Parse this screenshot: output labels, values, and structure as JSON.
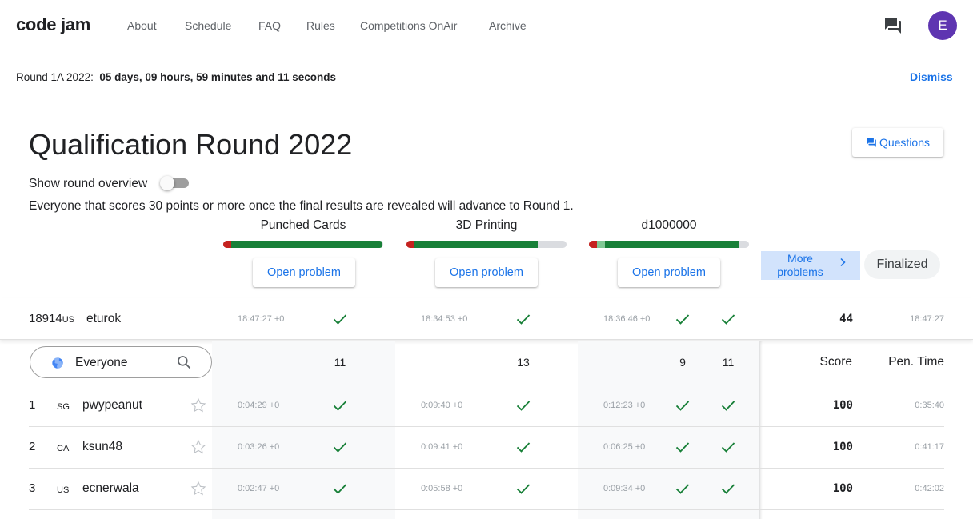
{
  "nav": {
    "logo": "code jam",
    "links": [
      "About",
      "Schedule",
      "FAQ",
      "Rules",
      "Competitions OnAir",
      "Archive"
    ],
    "avatar_letter": "E"
  },
  "countdown": {
    "label": "Round 1A 2022:",
    "time": "05 days, 09 hours, 59 minutes and 11 seconds",
    "dismiss": "Dismiss"
  },
  "header": {
    "title": "Qualification Round 2022",
    "questions_label": "Questions",
    "overview_label": "Show round overview",
    "advance_note": "Everyone that scores 30 points or more once the final results are revealed will advance to Round 1."
  },
  "problems": [
    {
      "name": "Punched Cards",
      "open_label": "Open problem"
    },
    {
      "name": "3D Printing",
      "open_label": "Open problem"
    },
    {
      "name": "d1000000",
      "open_label": "Open problem"
    }
  ],
  "more_problems_label": "More problems",
  "status_label": "Finalized",
  "user_row": {
    "rank": "18914",
    "country": "US",
    "handle": "eturok",
    "times": [
      "18:47:27 +0",
      "18:34:53 +0",
      "18:36:46 +0"
    ],
    "score": "44",
    "pen_time": "18:47:27"
  },
  "table_header": {
    "filter_value": "Everyone",
    "counts": [
      "11",
      "13",
      "9",
      "11"
    ],
    "score_label": "Score",
    "pen_label": "Pen. Time"
  },
  "rows": [
    {
      "rank": "1",
      "country": "SG",
      "handle": "pwypeanut",
      "times": [
        "0:04:29 +0",
        "0:09:40 +0",
        "0:12:23 +0"
      ],
      "score": "100",
      "pen_time": "0:35:40"
    },
    {
      "rank": "2",
      "country": "CA",
      "handle": "ksun48",
      "times": [
        "0:03:26 +0",
        "0:09:41 +0",
        "0:06:25 +0"
      ],
      "score": "100",
      "pen_time": "0:41:17"
    },
    {
      "rank": "3",
      "country": "US",
      "handle": "ecnerwala",
      "times": [
        "0:02:47 +0",
        "0:05:58 +0",
        "0:09:34 +0"
      ],
      "score": "100",
      "pen_time": "0:42:02"
    }
  ],
  "colors": {
    "accent": "#1a73e8",
    "check": "#188038",
    "fail": "#c5221f",
    "avatar": "#5e35b1"
  },
  "icons": [
    "chat-icon",
    "questions-icon",
    "chevron-right-icon",
    "globe-icon",
    "search-icon",
    "star-outline-icon",
    "check-icon"
  ]
}
